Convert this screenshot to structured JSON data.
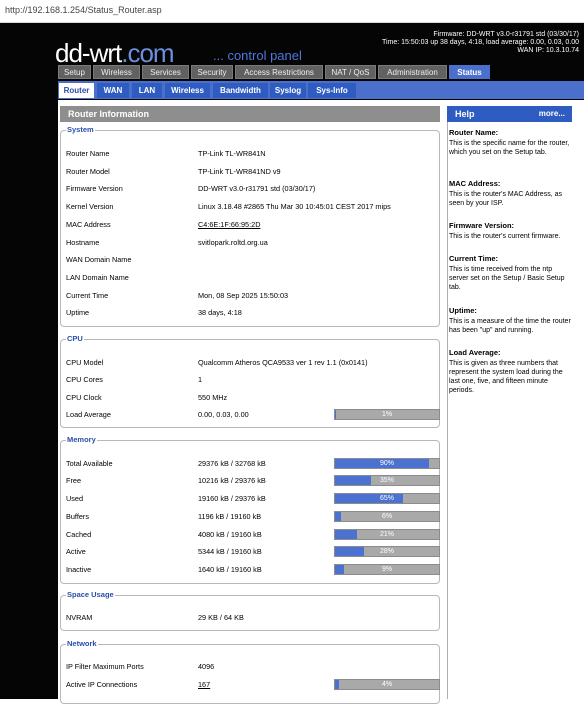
{
  "browser": {
    "url": "http://192.168.1.254/Status_Router.asp"
  },
  "header": {
    "logo_main": "dd-wrt",
    "logo_dot": ".com",
    "logo_sub": "... control panel",
    "firmware_line": "Firmware: DD-WRT v3.0-r31791 std (03/30/17)",
    "time_line": "Time: 15:50:03 up 38 days, 4:18, load average: 0.00, 0.03, 0.00",
    "wan_ip_line": "WAN IP: 10.3.10.74"
  },
  "main_tabs": [
    "Setup",
    "Wireless",
    "Services",
    "Security",
    "Access Restrictions",
    "NAT / QoS",
    "Administration",
    "Status"
  ],
  "sub_tabs": [
    "Router",
    "WAN",
    "LAN",
    "Wireless",
    "Bandwidth",
    "Syslog",
    "Sys-Info"
  ],
  "section_title": "Router Information",
  "system": {
    "legend": "System",
    "rows": [
      {
        "label": "Router Name",
        "value": "TP-Link TL-WR841N"
      },
      {
        "label": "Router Model",
        "value": "TP-Link TL-WR841ND v9"
      },
      {
        "label": "Firmware Version",
        "value": "DD-WRT v3.0-r31791 std (03/30/17)"
      },
      {
        "label": "Kernel Version",
        "value": "Linux 3.18.48 #2865 Thu Mar 30 10:45:01 CEST 2017 mips"
      },
      {
        "label": "MAC Address",
        "value": "C4:6E:1F:66:95:2D"
      },
      {
        "label": "Hostname",
        "value": "svitlopark.roltd.org.ua"
      },
      {
        "label": "WAN Domain Name",
        "value": ""
      },
      {
        "label": "LAN Domain Name",
        "value": ""
      },
      {
        "label": "Current Time",
        "value": "Mon, 08 Sep 2025 15:50:03"
      },
      {
        "label": "Uptime",
        "value": "38 days, 4:18"
      }
    ]
  },
  "cpu": {
    "legend": "CPU",
    "rows": [
      {
        "label": "CPU Model",
        "value": "Qualcomm Atheros QCA9533 ver 1 rev 1.1 (0x0141)"
      },
      {
        "label": "CPU Cores",
        "value": "1"
      },
      {
        "label": "CPU Clock",
        "value": "550 MHz"
      },
      {
        "label": "Load Average",
        "value": "0.00, 0.03, 0.00",
        "pct_text": "1%",
        "fill": 0.01
      }
    ]
  },
  "memory": {
    "legend": "Memory",
    "rows": [
      {
        "label": "Total Available",
        "value": "29376 kB / 32768 kB",
        "pct_text": "90%",
        "fill": 0.9
      },
      {
        "label": "Free",
        "value": "10216 kB / 29376 kB",
        "pct_text": "35%",
        "fill": 0.35
      },
      {
        "label": "Used",
        "value": "19160 kB / 29376 kB",
        "pct_text": "65%",
        "fill": 0.65
      },
      {
        "label": "Buffers",
        "value": "1196 kB / 19160 kB",
        "pct_text": "6%",
        "fill": 0.06
      },
      {
        "label": "Cached",
        "value": "4080 kB / 19160 kB",
        "pct_text": "21%",
        "fill": 0.21
      },
      {
        "label": "Active",
        "value": "5344 kB / 19160 kB",
        "pct_text": "28%",
        "fill": 0.28
      },
      {
        "label": "Inactive",
        "value": "1640 kB / 19160 kB",
        "pct_text": "9%",
        "fill": 0.09
      }
    ]
  },
  "space": {
    "legend": "Space Usage",
    "rows": [
      {
        "label": "NVRAM",
        "value": "29 KB / 64 KB"
      }
    ]
  },
  "network": {
    "legend": "Network",
    "rows": [
      {
        "label": "IP Filter Maximum Ports",
        "value": "4096"
      },
      {
        "label": "Active IP Connections",
        "value": "167",
        "pct_text": "4%",
        "fill": 0.04
      }
    ]
  },
  "help": {
    "title": "Help",
    "more": "more...",
    "blocks": [
      {
        "title": "Router Name:",
        "text": "This is the specific name for the router, which you set on the Setup tab."
      },
      {
        "title": "MAC Address:",
        "text": "This is the router's MAC Address, as seen by your ISP."
      },
      {
        "title": "Firmware Version:",
        "text": "This is the router's current firmware."
      },
      {
        "title": "Current Time:",
        "text": "This is time received from the ntp server set on the Setup / Basic Setup tab."
      },
      {
        "title": "Uptime:",
        "text": "This is a measure of the time the router has been \"up\" and running."
      },
      {
        "title": "Load Average:",
        "text": "This is given as three numbers that represent the system load during the last one, five, and fifteen minute periods."
      }
    ]
  },
  "colors": {
    "accent": "#4a70cc",
    "dark_bg": "#050505",
    "tab_bg": "#616161",
    "bar_bg": "#a9a9a9"
  }
}
